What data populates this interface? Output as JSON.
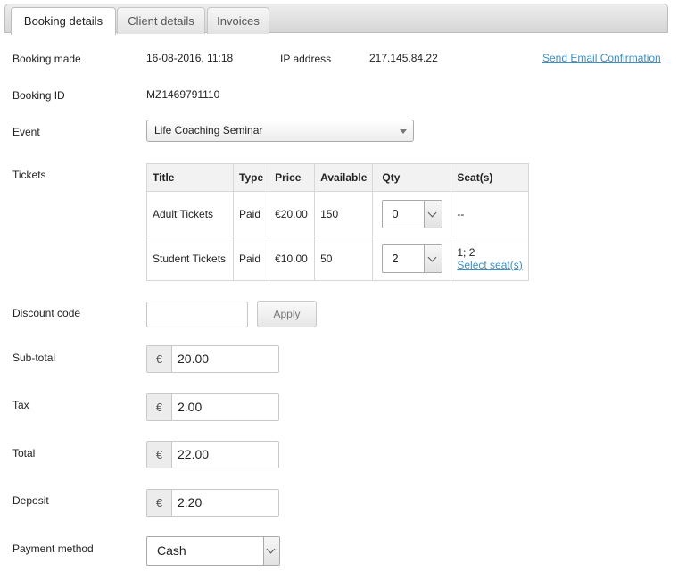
{
  "tabs": [
    {
      "label": "Booking details",
      "active": true
    },
    {
      "label": "Client details",
      "active": false
    },
    {
      "label": "Invoices",
      "active": false
    }
  ],
  "booking": {
    "made_label": "Booking made",
    "made_value": "16-08-2016, 11:18",
    "ip_label": "IP address",
    "ip_value": "217.145.84.22",
    "send_email_link": "Send Email Confirmation",
    "id_label": "Booking ID",
    "id_value": "MZ1469791110",
    "event_label": "Event",
    "event_value": "Life Coaching Seminar",
    "tickets_label": "Tickets"
  },
  "tickets": {
    "headers": [
      "Title",
      "Type",
      "Price",
      "Available",
      "Qty",
      "Seat(s)"
    ],
    "rows": [
      {
        "title": "Adult Tickets",
        "type": "Paid",
        "price": "€20.00",
        "available": "150",
        "qty": "0",
        "seats": "--",
        "seat_link": ""
      },
      {
        "title": "Student Tickets",
        "type": "Paid",
        "price": "€10.00",
        "available": "50",
        "qty": "2",
        "seats": "1; 2",
        "seat_link": "Select seat(s)"
      }
    ]
  },
  "discount": {
    "label": "Discount code",
    "value": "",
    "apply_label": "Apply"
  },
  "totals": {
    "currency": "€",
    "subtotal_label": "Sub-total",
    "subtotal": "20.00",
    "tax_label": "Tax",
    "tax": "2.00",
    "total_label": "Total",
    "total": "22.00",
    "deposit_label": "Deposit",
    "deposit": "2.20"
  },
  "payment": {
    "label": "Payment method",
    "value": "Cash"
  }
}
